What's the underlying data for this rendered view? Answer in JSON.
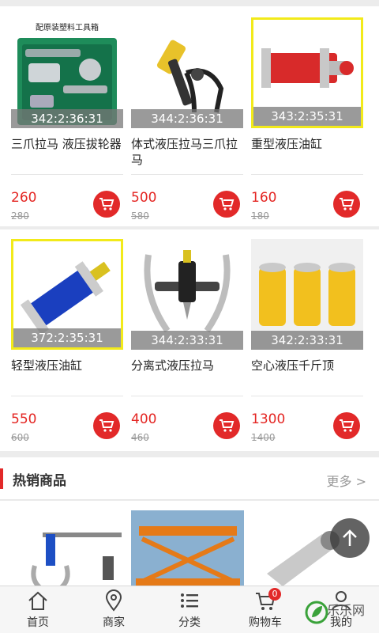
{
  "products_row1": [
    {
      "timer": "342:2:36:31",
      "name": "三爪拉马 液压拔轮器",
      "price": "260",
      "original_price": "280",
      "highlighted": false,
      "icon": "three-jaw-puller-kit"
    },
    {
      "timer": "344:2:36:31",
      "name": "体式液压拉马三爪拉马",
      "price": "500",
      "original_price": "580",
      "highlighted": false,
      "icon": "hydraulic-puller"
    },
    {
      "timer": "343:2:35:31",
      "name": "重型液压油缸",
      "price": "160",
      "original_price": "180",
      "highlighted": true,
      "icon": "red-hydraulic-cylinder"
    }
  ],
  "products_row2": [
    {
      "timer": "372:2:35:31",
      "name": "轻型液压油缸",
      "price": "550",
      "original_price": "600",
      "highlighted": true,
      "icon": "blue-hydraulic-cylinder"
    },
    {
      "timer": "344:2:33:31",
      "name": "分离式液压拉马",
      "price": "400",
      "original_price": "460",
      "highlighted": false,
      "icon": "split-hydraulic-puller"
    },
    {
      "timer": "342:2:33:31",
      "name": "空心液压千斤顶",
      "price": "1300",
      "original_price": "1400",
      "highlighted": false,
      "icon": "hollow-jacks"
    }
  ],
  "kit_box_label": "配原装塑料工具箱",
  "hot": {
    "title": "热销商品",
    "more": "更多 >"
  },
  "tabs": [
    {
      "label": "首页",
      "icon": "home-icon"
    },
    {
      "label": "商家",
      "icon": "location-pin-icon"
    },
    {
      "label": "分类",
      "icon": "list-icon"
    },
    {
      "label": "购物车",
      "icon": "cart-icon",
      "badge": "0"
    },
    {
      "label": "我的",
      "icon": "user-icon"
    }
  ],
  "watermark": "乐乐网",
  "colors": {
    "accent": "#e22929",
    "highlight": "#f2ea1a",
    "price": "#e42623"
  }
}
